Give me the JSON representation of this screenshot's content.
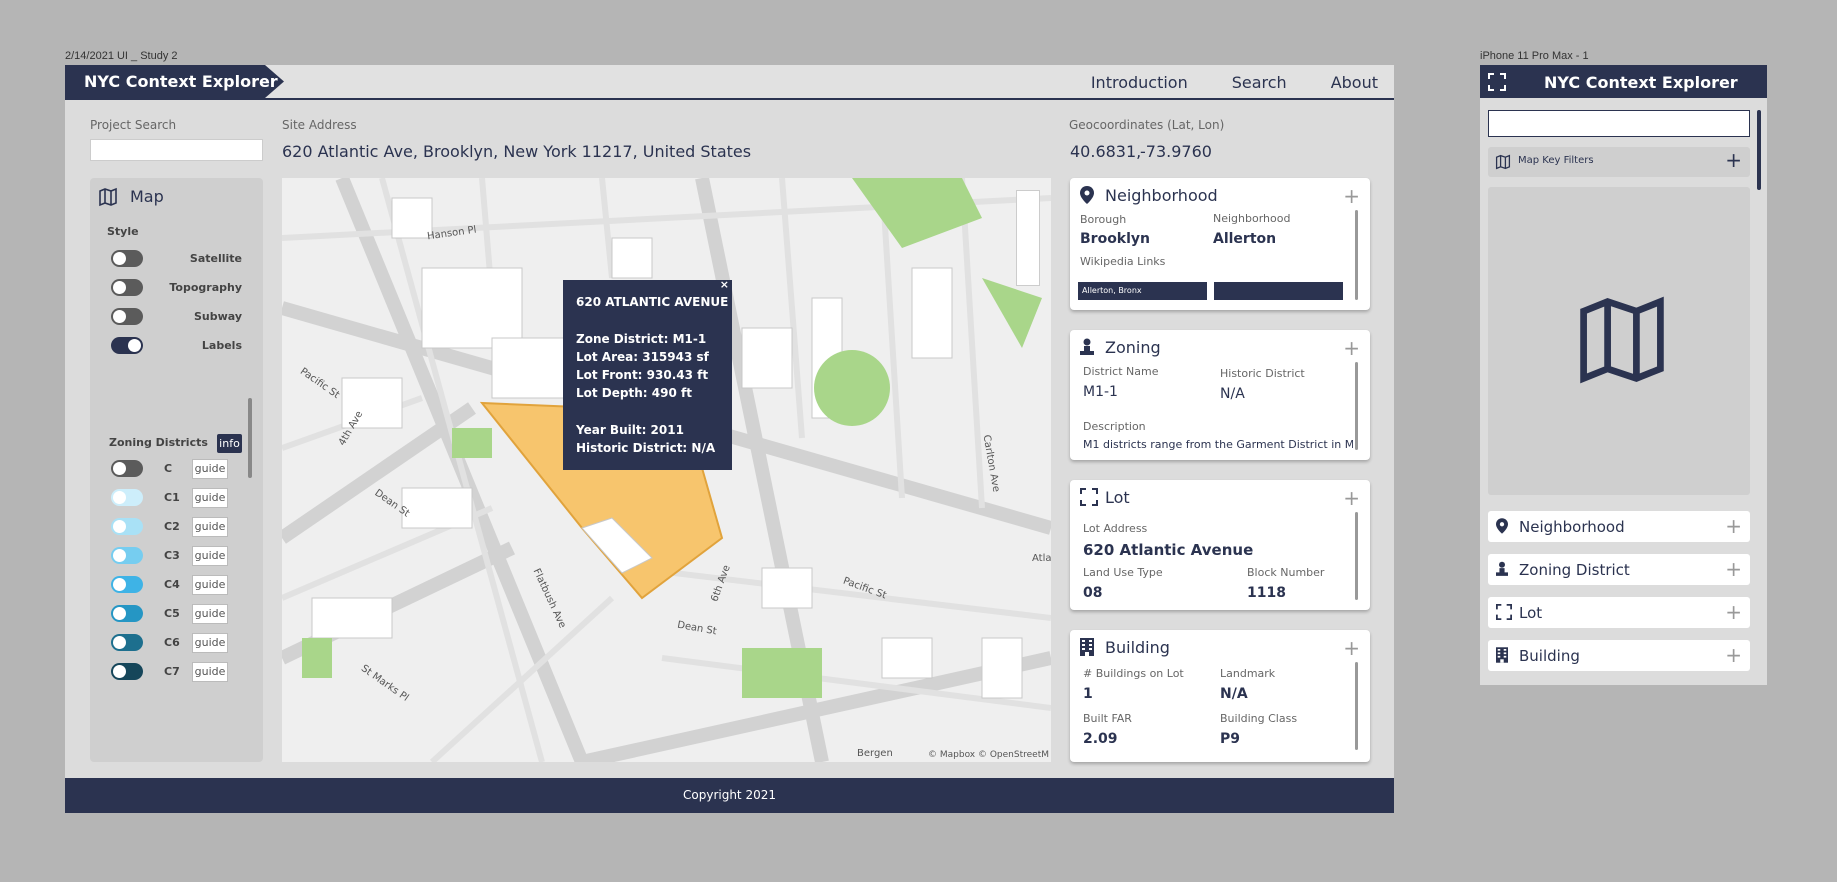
{
  "labels": {
    "desktop_frame": "2/14/2021 UI _ Study 2",
    "mobile_frame": "iPhone 11 Pro Max - 1"
  },
  "app": {
    "title": "NYC Context Explorer"
  },
  "nav": [
    "Introduction",
    "Search",
    "About"
  ],
  "project_search": {
    "label": "Project Search",
    "value": ""
  },
  "site_address": {
    "label": "Site Address",
    "value": "620 Atlantic Ave, Brooklyn, New York 11217, United States"
  },
  "geo": {
    "label": "Geocoordinates (Lat, Lon)",
    "lat": "40.6831,",
    "lon": "-73.9760"
  },
  "sidebar": {
    "title": "Map",
    "style_label": "Style",
    "layers": [
      {
        "label": "Satellite",
        "on": false
      },
      {
        "label": "Topography",
        "on": false
      },
      {
        "label": "Subway",
        "on": false
      },
      {
        "label": "Labels",
        "on": true
      }
    ],
    "zoning_label": "Zoning Districts",
    "info_label": "info",
    "guide_label": "guide",
    "zones": [
      {
        "label": "C",
        "color": "#5b5b5b"
      },
      {
        "label": "C1",
        "color": "#cdeefb"
      },
      {
        "label": "C2",
        "color": "#a9e1f6"
      },
      {
        "label": "C3",
        "color": "#76cdf0"
      },
      {
        "label": "C4",
        "color": "#3eb3e6"
      },
      {
        "label": "C5",
        "color": "#2596c4"
      },
      {
        "label": "C6",
        "color": "#1d6f8e"
      },
      {
        "label": "C7",
        "color": "#16465a"
      }
    ]
  },
  "map": {
    "popup": {
      "title": "620 ATLANTIC AVENUE",
      "zone": "Zone District: M1-1",
      "area": "Lot Area: 315943 sf",
      "front": "Lot Front: 930.43 ft",
      "depth": "Lot Depth: 490 ft",
      "year": "Year Built: 2011",
      "historic": "Historic District: N/A"
    },
    "streets": [
      "Hanson Pl",
      "Pacific St",
      "4th Ave",
      "Dean St",
      "Flatbush Ave",
      "St Marks Pl",
      "6th Ave",
      "Pacific St",
      "Dean St",
      "Carlton Ave",
      "Atla",
      "Bergen"
    ],
    "attribution": "© Mapbox © OpenStreetM",
    "close": "×"
  },
  "cards": {
    "neighborhood": {
      "title": "Neighborhood",
      "borough_label": "Borough",
      "borough": "Brooklyn",
      "nb_label": "Neighborhood",
      "nb": "Allerton",
      "wiki_label": "Wikipedia Links",
      "wiki_link": "Allerton, Bronx"
    },
    "zoning": {
      "title": "Zoning",
      "district_label": "District Name",
      "district": "M1-1",
      "historic_label": "Historic District",
      "historic": "N/A",
      "desc_label": "Description",
      "desc": "M1 districts range from the Garment District in Manhat"
    },
    "lot": {
      "title": "Lot",
      "addr_label": "Lot Address",
      "addr": "620 Atlantic Avenue",
      "use_label": "Land Use Type",
      "use": "08",
      "block_label": "Block Number",
      "block": "1118"
    },
    "building": {
      "title": "Building",
      "count_label": "# Buildings on Lot",
      "count": "1",
      "landmark_label": "Landmark",
      "landmark": "N/A",
      "far_label": "Built FAR",
      "far": "2.09",
      "class_label": "Building Class",
      "class": "P9"
    }
  },
  "footer": "Copyright 2021",
  "mobile": {
    "title": "NYC Context Explorer",
    "filters_label": "Map Key Filters",
    "items": [
      "Neighborhood",
      "Zoning District",
      "Lot",
      "Building"
    ]
  }
}
